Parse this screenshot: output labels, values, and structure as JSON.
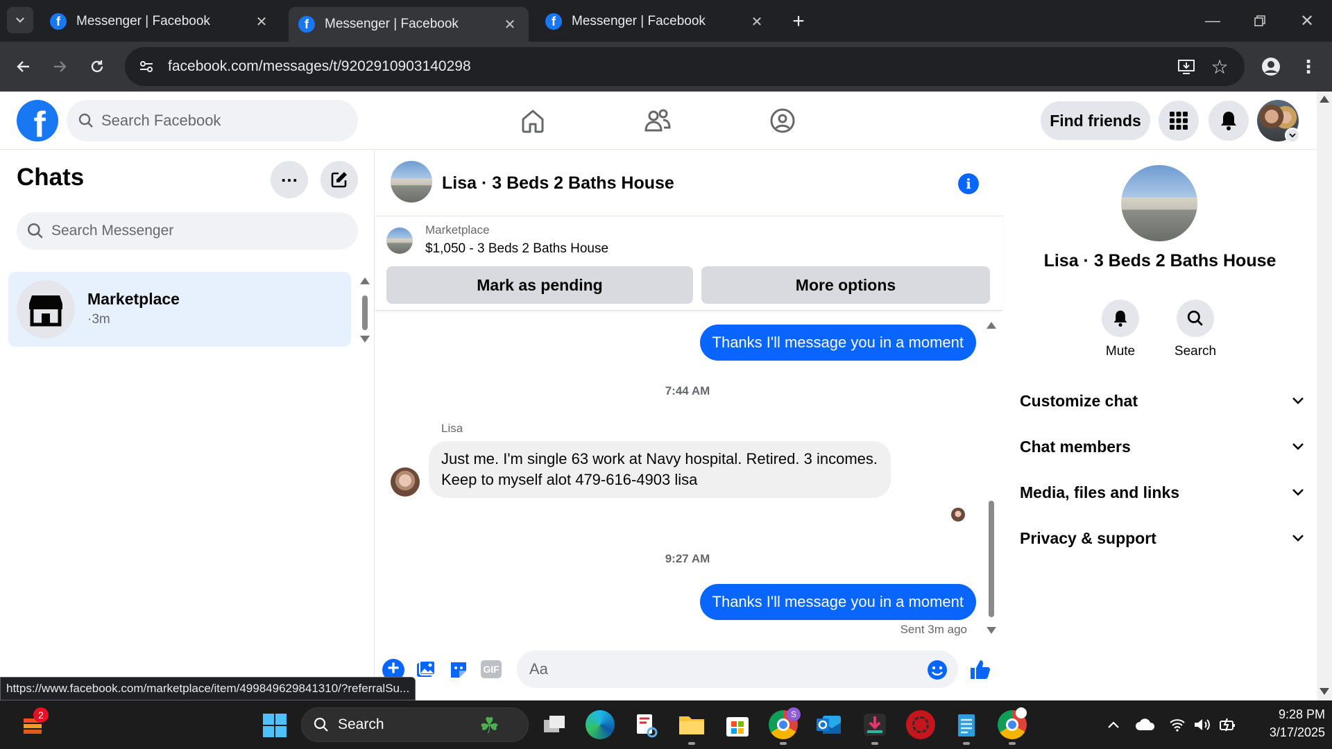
{
  "browser": {
    "tabs": [
      {
        "title": "Messenger | Facebook",
        "active": false
      },
      {
        "title": "Messenger | Facebook",
        "active": true
      },
      {
        "title": "Messenger | Facebook",
        "active": false
      }
    ],
    "url": "facebook.com/messages/t/9202910903140298",
    "status_link": "https://www.facebook.com/marketplace/item/499849629841310/?referralSu..."
  },
  "fb_header": {
    "logo": "f",
    "search_placeholder": "Search Facebook",
    "find_friends": "Find friends"
  },
  "chats": {
    "title": "Chats",
    "search_placeholder": "Search Messenger",
    "items": [
      {
        "name": "Marketplace",
        "meta": "·3m"
      }
    ]
  },
  "conversation": {
    "title": "Lisa · 3 Beds 2 Baths House",
    "marketplace_label": "Marketplace",
    "listing": "$1,050 - 3 Beds 2 Baths House",
    "mark_pending": "Mark as pending",
    "more_options": "More options",
    "messages": [
      {
        "type": "out",
        "text": "Thanks I'll message you in a moment"
      },
      {
        "type": "stamp",
        "text": "7:44 AM"
      },
      {
        "type": "sender",
        "text": "Lisa"
      },
      {
        "type": "in",
        "line1": "Just me. I'm single 63 work at Navy hospital. Retired. 3 incomes.",
        "line2": "Keep to myself alot 479-616-4903 lisa"
      },
      {
        "type": "stamp",
        "text": "9:27 AM"
      },
      {
        "type": "out",
        "text": "Thanks I'll message you in a moment"
      },
      {
        "type": "status",
        "text": "Sent 3m ago"
      }
    ],
    "input_placeholder": "Aa",
    "gif_label": "GIF"
  },
  "details": {
    "name": "Lisa · 3 Beds 2 Baths House",
    "mute": "Mute",
    "search": "Search",
    "sections": [
      "Customize chat",
      "Chat members",
      "Media, files and links",
      "Privacy & support"
    ]
  },
  "taskbar": {
    "search_label": "Search",
    "widget_badge": "2",
    "chrome_badge": "S",
    "time": "9:28 PM",
    "date": "3/17/2025"
  },
  "colors": {
    "fb_blue": "#1877f2",
    "bubble_out": "#0866ff",
    "chat_selected": "#e7f1fd",
    "chrome_dark": "#202124"
  }
}
